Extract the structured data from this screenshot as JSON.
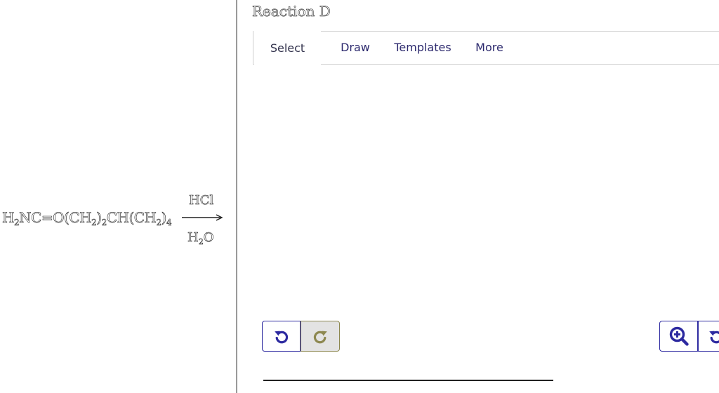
{
  "question": {
    "reactant_main": "H",
    "reactant_sub1": "2",
    "reactant_mid1": "NC=O(CH",
    "reactant_sub2": "2",
    "reactant_mid2": ")",
    "reactant_sub3": "2",
    "reactant_mid3": "CH(CH",
    "reactant_sub4": "2",
    "reactant_mid4": ")",
    "reactant_sub5": "4",
    "reagent_above": "HCl",
    "reagent_below_main": "H",
    "reagent_below_sub": "2",
    "reagent_below_end": "O"
  },
  "editor": {
    "title": "Reaction D",
    "tabs": [
      {
        "label": "Select",
        "active": true
      },
      {
        "label": "Draw",
        "active": false
      },
      {
        "label": "Templates",
        "active": false
      },
      {
        "label": "More",
        "active": false
      }
    ],
    "buttons": {
      "undo_icon": "undo-icon",
      "redo_icon": "redo-icon",
      "zoom_in_icon": "zoom-in-icon",
      "rotate_icon": "rotate-icon"
    }
  },
  "colors": {
    "accent": "#2d2aa0",
    "tab_text": "#2d2a6e",
    "redo_border": "#8d8850",
    "redo_bg": "#e3e3e3",
    "redo_icon": "#8d8850"
  }
}
